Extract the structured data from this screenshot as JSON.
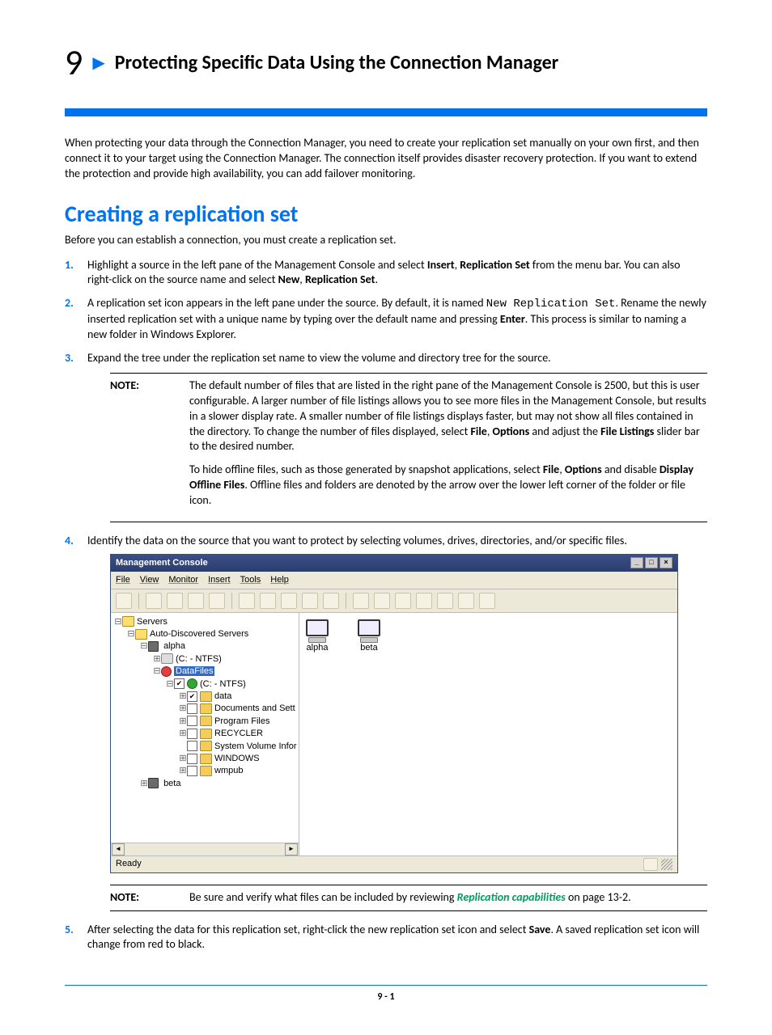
{
  "chapter": {
    "number": "9",
    "title": "Protecting Specific Data Using the Connection Manager"
  },
  "intro": "When protecting your data through the Connection Manager, you need to create your replication set manually on your own first, and then connect it to your target using the Connection Manager.  The connection itself provides disaster recovery protection. If you want to extend the protection and provide high availability, you can add failover monitoring.",
  "section": {
    "title": "Creating a replication set",
    "lead": "Before you can establish a connection, you must create a replication set."
  },
  "steps": {
    "s1": {
      "a": "Highlight a source in the left pane of the Management Console and select ",
      "b1": "Insert",
      "b2": ", ",
      "b3": "Replication Set",
      "c": " from the menu bar.  You can also right-click on the source name and select ",
      "d1": "New",
      "d2": ", ",
      "d3": "Replication Set",
      "e": "."
    },
    "s2": {
      "a": "A replication set icon appears in the left pane under the source. By default, it is named ",
      "code": "New Replication Set",
      "b": ". Rename the newly inserted replication set with a unique name by typing over the default name and pressing ",
      "enter": "Enter",
      "c": ". This process is similar to naming a new folder in Windows Explorer."
    },
    "s3": "Expand the tree under the replication set name to view the volume and directory tree for the source.",
    "s4": "Identify the data on the source that you want to protect by selecting volumes, drives, directories, and/or specific files.",
    "s5": {
      "a": "After selecting the data for this replication set, right-click the new replication set icon and select ",
      "save": "Save",
      "b": ".  A saved replication set icon will  change from red to black."
    }
  },
  "note1": {
    "label": "NOTE:",
    "p1a": "The default number of files that are listed in the right pane of the Management Console is 2500, but this is user configurable.   A larger number of file listings allows you to see more files in the Management Console, but results in a slower display rate.  A smaller number of file listings displays faster, but may not show all files contained in the directory. To change the number of files displayed, select ",
    "p1b1": "File",
    "p1b2": ", ",
    "p1b3": "Options",
    "p1c": " and adjust the ",
    "p1d": "File Listings",
    "p1e": " slider bar to the desired number.",
    "p2a": "To hide offline files, such as those generated by snapshot applications, select ",
    "p2b1": "File",
    "p2b2": ", ",
    "p2b3": "Options",
    "p2c": " and disable ",
    "p2d": "Display Offline Files",
    "p2e": ". Offline files and folders are denoted by the arrow over the lower left corner of the folder or file icon."
  },
  "note2": {
    "label": "NOTE:",
    "a": "Be sure and verify what files can be included by reviewing ",
    "link": "Replication capabilities",
    "b": " on page 13-2."
  },
  "mc": {
    "title": "Management Console",
    "menus": [
      "File",
      "View",
      "Monitor",
      "Insert",
      "Tools",
      "Help"
    ],
    "status": "Ready",
    "computers": [
      "alpha",
      "beta"
    ],
    "tree": {
      "root": "Servers",
      "auto": "Auto-Discovered Servers",
      "alpha": "alpha",
      "c1": "(C: - NTFS)",
      "datafiles": "DataFiles",
      "c2": "(C: - NTFS)",
      "data": "data",
      "docs": "Documents and Sett",
      "prog": "Program Files",
      "recycler": "RECYCLER",
      "sysvol": "System Volume Infor",
      "windows": "WINDOWS",
      "wmpub": "wmpub",
      "beta": "beta"
    }
  },
  "footer": {
    "page": "9 - 1"
  }
}
